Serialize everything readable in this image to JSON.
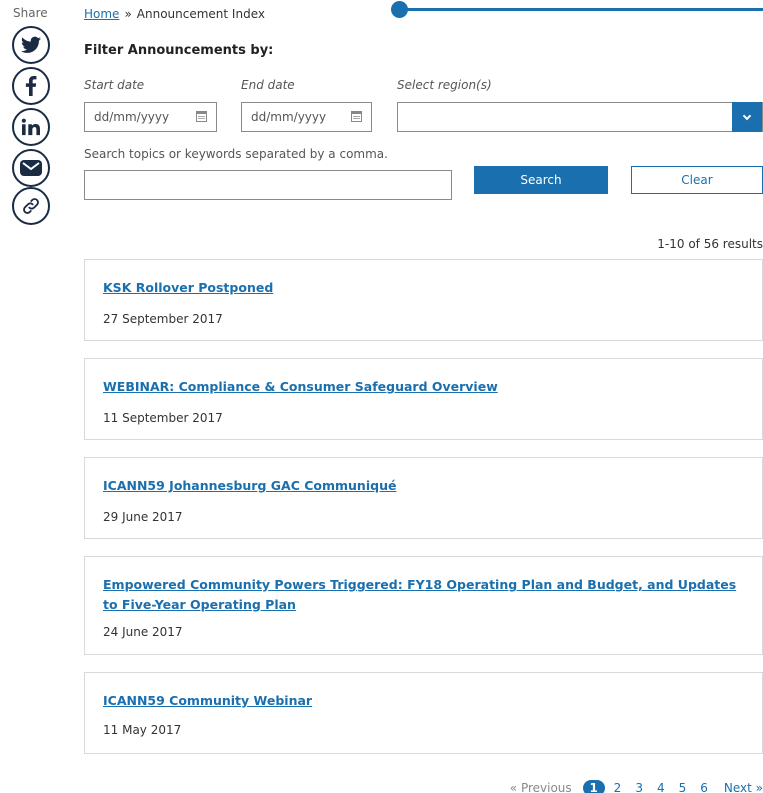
{
  "share": {
    "label": "Share",
    "buttons": [
      "twitter-icon",
      "facebook-icon",
      "linkedin-icon",
      "email-icon",
      "link-icon"
    ]
  },
  "breadcrumb": {
    "home": "Home",
    "separator": "»",
    "current": "Announcement Index"
  },
  "slider": {
    "value": 0
  },
  "filter": {
    "title": "Filter Announcements by:",
    "start_label": "Start date",
    "start_placeholder": "dd/mm/yyyy",
    "end_label": "End date",
    "end_placeholder": "dd/mm/yyyy",
    "region_label": "Select region(s)",
    "region_value": "",
    "keywords_hint": "Search topics or keywords separated by a comma.",
    "keywords_value": "",
    "search_label": "Search",
    "clear_label": "Clear"
  },
  "results": {
    "count": "1-10 of 56 results"
  },
  "announcements": [
    {
      "title": "KSK Rollover Postponed",
      "date": "27 September 2017"
    },
    {
      "title": "WEBINAR: Compliance & Consumer Safeguard Overview",
      "date": "11 September 2017"
    },
    {
      "title": "ICANN59 Johannesburg GAC Communiqué",
      "date": "29 June 2017"
    },
    {
      "title": "Empowered Community Powers Triggered: FY18 Operating Plan and Budget, and Updates to Five-Year Operating Plan",
      "date": "24 June 2017"
    },
    {
      "title": "ICANN59 Community Webinar",
      "date": "11 May 2017"
    }
  ],
  "pagination": {
    "prev": "« Previous",
    "current": "1",
    "pages": [
      "2",
      "3",
      "4",
      "5",
      "6"
    ],
    "next": "Next »"
  },
  "colors": {
    "accent": "#1a6fae",
    "icon_dark": "#1a2b44",
    "border": "#d9d9d9"
  }
}
